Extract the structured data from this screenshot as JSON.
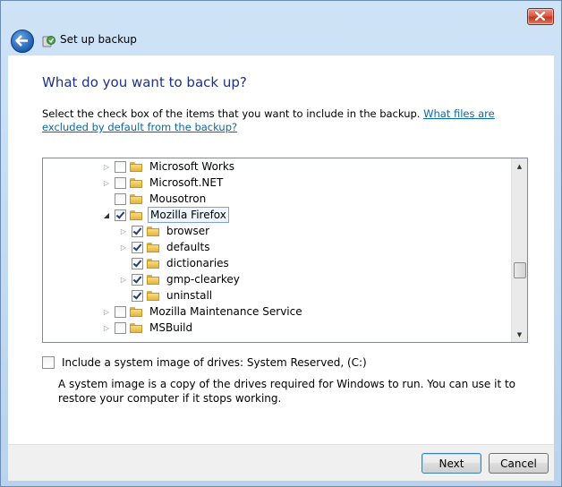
{
  "window": {
    "title": "Set up backup"
  },
  "content": {
    "heading": "What do you want to back up?",
    "instructions_text": "Select the check box of the items that you want to include in the backup. ",
    "instructions_link": "What files are excluded by default from the backup?"
  },
  "tree": {
    "items": [
      {
        "label": "Microsoft Works",
        "checked": false,
        "expander": "collapsed"
      },
      {
        "label": "Microsoft.NET",
        "checked": false,
        "expander": "collapsed"
      },
      {
        "label": "Mousotron",
        "checked": false,
        "expander": "none"
      },
      {
        "label": "Mozilla Firefox",
        "checked": true,
        "expander": "expanded"
      },
      {
        "label": "browser",
        "checked": true,
        "expander": "collapsed"
      },
      {
        "label": "defaults",
        "checked": true,
        "expander": "collapsed"
      },
      {
        "label": "dictionaries",
        "checked": true,
        "expander": "none"
      },
      {
        "label": "gmp-clearkey",
        "checked": true,
        "expander": "collapsed"
      },
      {
        "label": "uninstall",
        "checked": true,
        "expander": "none"
      },
      {
        "label": "Mozilla Maintenance Service",
        "checked": false,
        "expander": "collapsed"
      },
      {
        "label": "MSBuild",
        "checked": false,
        "expander": "collapsed"
      }
    ]
  },
  "system_image": {
    "label": "Include a system image of drives: System Reserved, (C:)",
    "checked": false,
    "description": "A system image is a copy of the drives required for Windows to run. You can use it to restore your computer if it stops working."
  },
  "footer": {
    "next_label": "Next",
    "cancel_label": "Cancel"
  },
  "icons": {
    "back": "back-arrow-icon",
    "app": "backup-icon",
    "close": "close-icon",
    "folder": "folder-icon",
    "scroll_up": "scroll-up-arrow-icon",
    "scroll_down": "scroll-down-arrow-icon"
  },
  "colors": {
    "heading": "#1e3287",
    "link": "#0b67a8",
    "close_button": "#c3371f"
  }
}
